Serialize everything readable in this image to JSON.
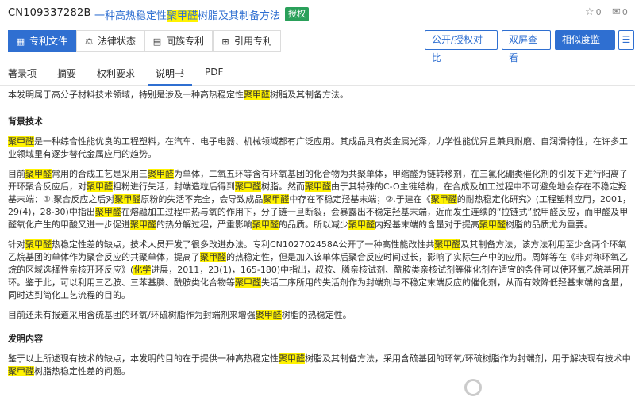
{
  "header": {
    "patent_number": "CN109337282B",
    "title_pre": "一种高热稳定性",
    "title_hl": "聚甲醛",
    "title_post": "树脂及其制备方法",
    "status_badge": "授权",
    "favorites": "0",
    "comments": "0"
  },
  "tabs_primary": [
    {
      "icon": "▦",
      "label": "专利文件"
    },
    {
      "icon": "⚖",
      "label": "法律状态"
    },
    {
      "icon": "▤",
      "label": "同族专利"
    },
    {
      "icon": "⊞",
      "label": "引用专利"
    }
  ],
  "actions": {
    "compare": "公开/授权对比",
    "dual_view": "双屏查看",
    "similarity": "相似度监控",
    "more": "☰"
  },
  "tabs_secondary": [
    "著录项",
    "摘要",
    "权利要求",
    "说明书",
    "PDF"
  ],
  "content": {
    "intro": [
      "本发明属于高分子材料技术领域，特别是涉及一种高热稳定性",
      "聚甲醛",
      "树脂及其制备方法。"
    ],
    "heading_bg": "背景技术",
    "p1": [
      "聚甲醛",
      "是一种综合性能优良的工程塑料，在汽车、电子电器、机械领域都有广泛应用。其成品具有类金属光泽，力学性能优异且兼具耐磨、自润滑特性，在许多工业领域里有逐步替代金属应用的趋势。"
    ],
    "p2": [
      "目前",
      "聚甲醛",
      "常用的合成工艺是采用三",
      "聚甲醛",
      "为单体，二氧五环等含有环氧基团的化合物为共聚单体，甲缩醛为链转移剂，在三氟化硼类催化剂的引发下进行阳离子开环聚合反应后，对",
      "聚甲醛",
      "粗粉进行失活，封端造粒后得到",
      "聚甲醛",
      "树脂。然而",
      "聚甲醛",
      "由于其特殊的C-O主链结构，在合成及加工过程中不可避免地会存在不稳定羟基末端：①.聚合反应之后对",
      "聚甲醛",
      "原粉的失活不完全，会导致成品",
      "聚甲醛",
      "中存在不稳定羟基末端；②.于建在《",
      "聚甲醛",
      "的耐热稳定化研究》(工程塑料应用，2001，29(4)，28-30)中指出",
      "聚甲醛",
      "在熔融加工过程中热与氧的作用下，分子链一旦断裂，会暴露出不稳定羟基末端，近而发生连续的“拉链式”脱甲醛反应，而甲醛及甲醛氧化产生的甲酸又进一步促进",
      "聚甲醛",
      "的热分解过程，严重影响",
      "聚甲醛",
      "的品质。所以减少",
      "聚甲醛",
      "内羟基末端的含量对于提高",
      "聚甲醛",
      "树脂的品质尤为重要。"
    ],
    "p3": [
      "针对",
      "聚甲醛",
      "热稳定性差的缺点，技术人员开发了很多改进办法。专利CN102702458A公开了一种高性能改性共",
      "聚甲醛",
      "及其制备方法，该方法利用至少含两个环氧乙烷基团的单体作为聚合反应的共聚单体，提高了",
      "聚甲醛",
      "的热稳定性，但是加入该单体后聚合反应时间过长，影响了实际生产中的应用。周婵等在《非对称环氧乙烷的区域选择性亲核开环反应》(",
      "化学",
      "进展，2011，23(1)，165-180)中指出，叔胺、膦亲核试剂、酰胺类亲核试剂等催化剂在适宜的条件可以使环氧乙烷基团开环。鉴于此，可以利用三乙胺、三苯基膦、酰胺类化合物等",
      "聚甲醛",
      "失活工序所用的失活剂作为封端剂与不稳定末端反应的催化剂，从而有效降低羟基末端的含量，同时达到简化工艺流程的目的。"
    ],
    "p4": [
      "目前还未有报道采用含硫基团的环氧/环硫树脂作为封端剂来增强",
      "聚甲醛",
      "树脂的热稳定性。"
    ],
    "heading_sum": "发明内容",
    "p5": [
      "鉴于以上所述现有技术的缺点，本发明的目的在于提供一种高热稳定性",
      "聚甲醛",
      "树脂及其制备方法，采用含硫基团的环氧/环硫树脂作为封端剂，用于解决现有技术中",
      "聚甲醛",
      "树脂热稳定性差的问题。"
    ]
  },
  "colors": {
    "accent": "#2f6fd1",
    "highlight": "#fff200",
    "badge": "#2aa05a"
  }
}
